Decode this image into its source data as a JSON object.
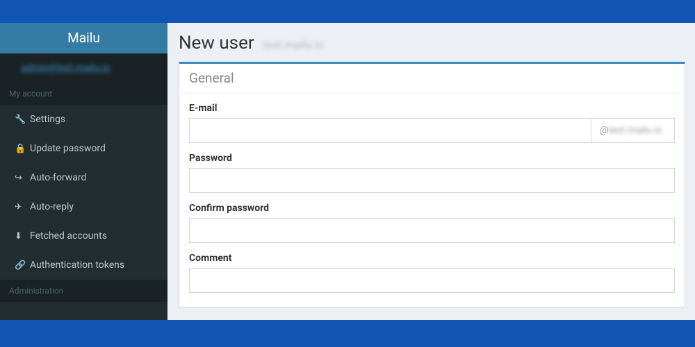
{
  "brand": "Mailu",
  "user_display": "admin@test.mailu.io",
  "sections": {
    "account": {
      "header": "My account",
      "items": [
        {
          "icon": "wrench",
          "label": "Settings"
        },
        {
          "icon": "lock",
          "label": "Update password"
        },
        {
          "icon": "share",
          "label": "Auto-forward"
        },
        {
          "icon": "plane",
          "label": "Auto-reply"
        },
        {
          "icon": "download",
          "label": "Fetched accounts"
        },
        {
          "icon": "link",
          "label": "Authentication tokens"
        }
      ]
    },
    "admin": {
      "header": "Administration"
    }
  },
  "page": {
    "title": "New user",
    "subtitle": "test.mailu.io"
  },
  "panel": {
    "title": "General",
    "fields": {
      "email_label": "E-mail",
      "email_value": "",
      "domain_suffix_at": "@",
      "domain_suffix_blur": "test.mailu.io",
      "password_label": "Password",
      "password_value": "",
      "confirm_label": "Confirm password",
      "confirm_value": "",
      "comment_label": "Comment",
      "comment_value": ""
    }
  },
  "icons": {
    "wrench": "🔧",
    "lock": "🔒",
    "share": "↪",
    "plane": "✈",
    "download": "⬇",
    "link": "🔗"
  }
}
